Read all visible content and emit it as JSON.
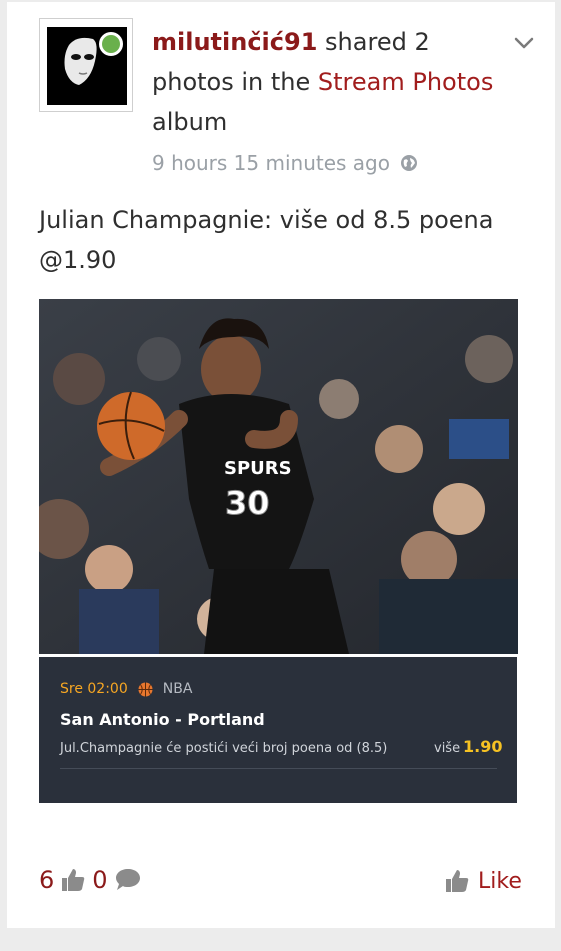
{
  "post": {
    "author": "milutinčić91",
    "header_middle": " shared 2 photos in the ",
    "album_name": "Stream Photos",
    "header_end": " album",
    "timestamp": "9 hours 15 minutes ago",
    "status_text": "Julian Champagnie: više od 8.5 poena @1.90"
  },
  "promo": {
    "time": "Sre 02:00",
    "league": "NBA",
    "match": "San Antonio - Portland",
    "description": "Jul.Champagnie će postići veći broj poena od (8.5)",
    "odd_label": "više",
    "odd_value": "1.90",
    "jersey_text": "SPURS",
    "jersey_number": "30"
  },
  "footer": {
    "likes_count": "6",
    "comments_count": "0",
    "like_label": "Like"
  },
  "colors": {
    "accent": "#8b1a1a",
    "link": "#a11d1d",
    "promo_bg": "#2a303b",
    "odd": "#f6c223",
    "time_orange": "#f6a623"
  },
  "icons": [
    "chevron-down-icon",
    "globe-icon",
    "basketball-icon",
    "thumbs-up-icon",
    "comment-icon"
  ]
}
